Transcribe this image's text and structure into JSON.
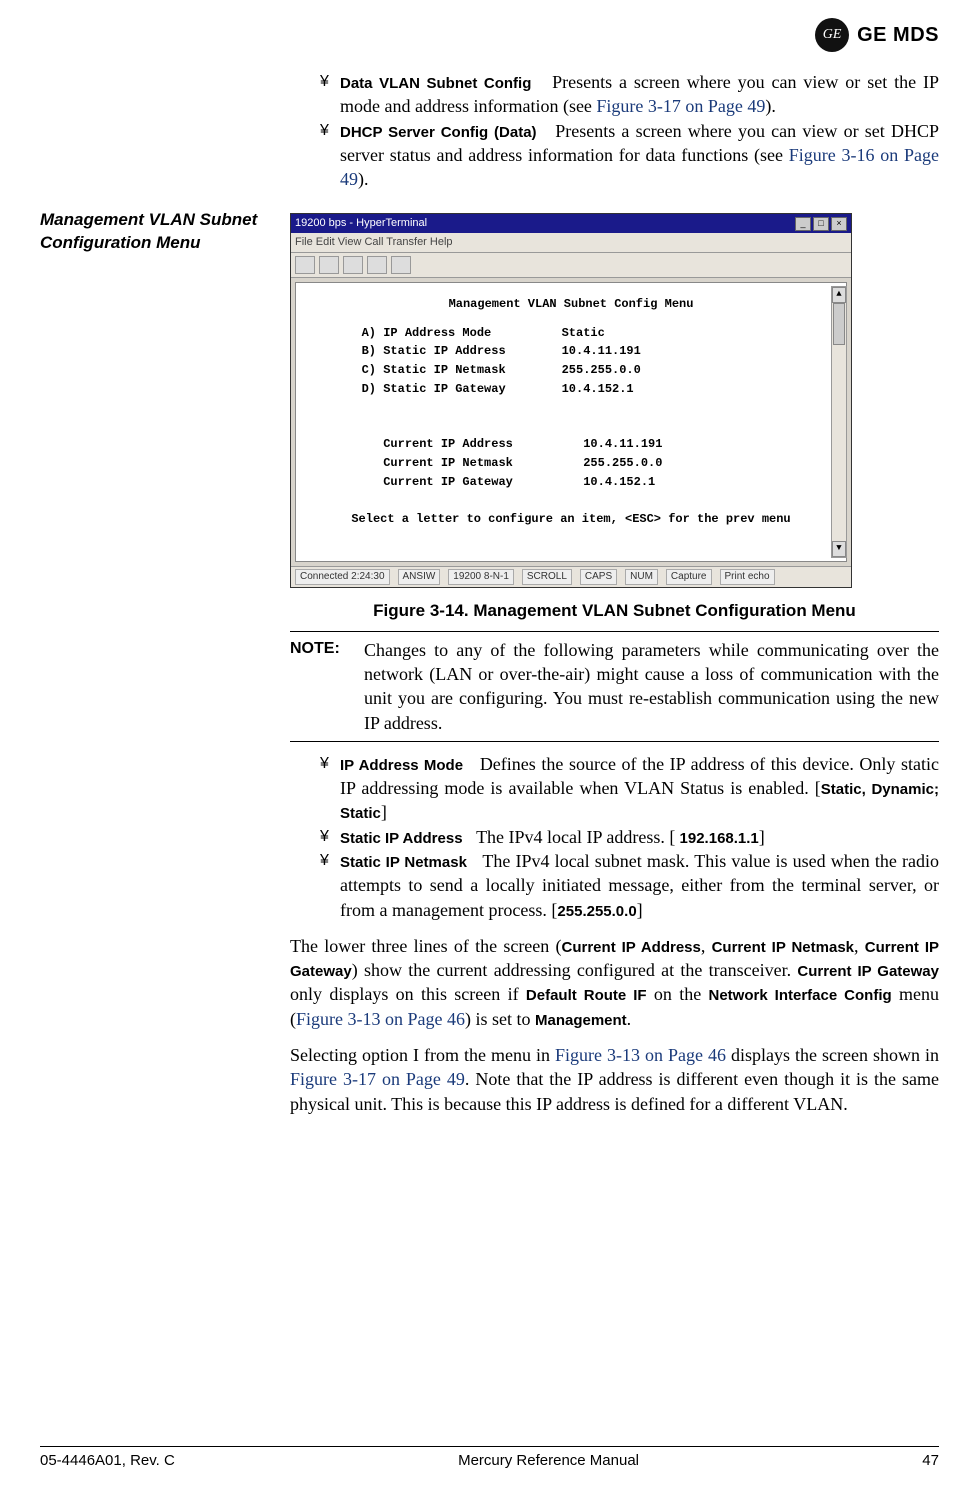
{
  "logo": {
    "monogram": "GE",
    "brand": "GE MDS"
  },
  "top_bullets": [
    {
      "term": "Data VLAN Subnet Config",
      "desc_pre": "Presents a screen where you can view or set the IP mode and address information (see ",
      "xref": "Figure 3-17 on Page 49",
      "desc_post": ")."
    },
    {
      "term": "DHCP Server Config (Data)",
      "desc_pre": "Presents a screen where you can view or set DHCP server status and address information for data functions (see ",
      "xref": "Figure 3-16 on Page 49",
      "desc_post": ")."
    }
  ],
  "side_heading": "Management VLAN Subnet Configuration Menu",
  "screenshot": {
    "window_title": "19200 bps - HyperTerminal",
    "menubar": "File   Edit   View   Call   Transfer   Help",
    "terminal": {
      "title": "Management VLAN Subnet Config Menu",
      "options": [
        {
          "key": "A)",
          "label": "IP Address Mode",
          "value": "Static"
        },
        {
          "key": "B)",
          "label": "Static IP Address",
          "value": "10.4.11.191"
        },
        {
          "key": "C)",
          "label": "Static IP Netmask",
          "value": "255.255.0.0"
        },
        {
          "key": "D)",
          "label": "Static IP Gateway",
          "value": "10.4.152.1"
        }
      ],
      "current": [
        {
          "label": "Current IP Address",
          "value": "10.4.11.191"
        },
        {
          "label": "Current IP Netmask",
          "value": "255.255.0.0"
        },
        {
          "label": "Current IP Gateway",
          "value": "10.4.152.1"
        }
      ],
      "prompt": "Select a letter to configure an item, <ESC> for the prev menu"
    },
    "statusbar": [
      "Connected 2:24:30",
      "ANSIW",
      "19200 8-N-1",
      "SCROLL",
      "CAPS",
      "NUM",
      "Capture",
      "Print echo"
    ]
  },
  "figure_caption": "Figure 3-14. Management VLAN Subnet Configuration Menu",
  "note": {
    "label": "NOTE:",
    "text": "Changes to any of the following parameters while communicating over the network (LAN or over-the-air) might cause a loss of communication with the unit you are configuring. You must re-establish communication using the new IP address."
  },
  "mid_bullets": [
    {
      "term": "IP Address Mode",
      "desc": "Defines the source of the IP address of this device. Only static IP addressing mode is available when VLAN Status is enabled. [",
      "code": "Static, Dynamic; Static",
      "desc_post": "]"
    },
    {
      "term": "Static IP Address",
      "desc": "The IPv4 local IP address. [",
      "code": " 192.168.1.1",
      "desc_post": "]"
    },
    {
      "term": "Static IP Netmask",
      "desc": "The IPv4 local subnet mask. This value is used when the radio attempts to send a locally initiated message, either from the terminal server, or from a management process. [",
      "code": "255.255.0.0",
      "desc_post": "]"
    }
  ],
  "para1": {
    "t1": "The lower three lines of the screen (",
    "c1": "Current IP Address",
    "t2": ", ",
    "c2": "Current IP Netmask",
    "t3": ", ",
    "c3": "Current IP Gateway",
    "t4": ") show the current addressing configured at the transceiver. ",
    "c4": "Current IP Gateway",
    "t5": " only displays on this screen if ",
    "c5": "Default Route IF",
    "t6": " on the ",
    "c6": "Network Interface Config",
    "t7": " menu (",
    "x1": "Figure 3-13 on Page 46",
    "t8": ") is set to ",
    "c7": "Management",
    "t9": "."
  },
  "para2": {
    "t1": "Selecting option I from the menu in ",
    "x1": "Figure 3-13 on Page 46",
    "t2": " displays the screen shown in ",
    "x2": "Figure 3-17 on Page 49",
    "t3": ". Note that the IP address is different even though it is the same physical unit. This is because this IP address is defined for a different VLAN."
  },
  "footer": {
    "left": "05-4446A01, Rev. C",
    "center": "Mercury Reference Manual",
    "right": "47"
  }
}
